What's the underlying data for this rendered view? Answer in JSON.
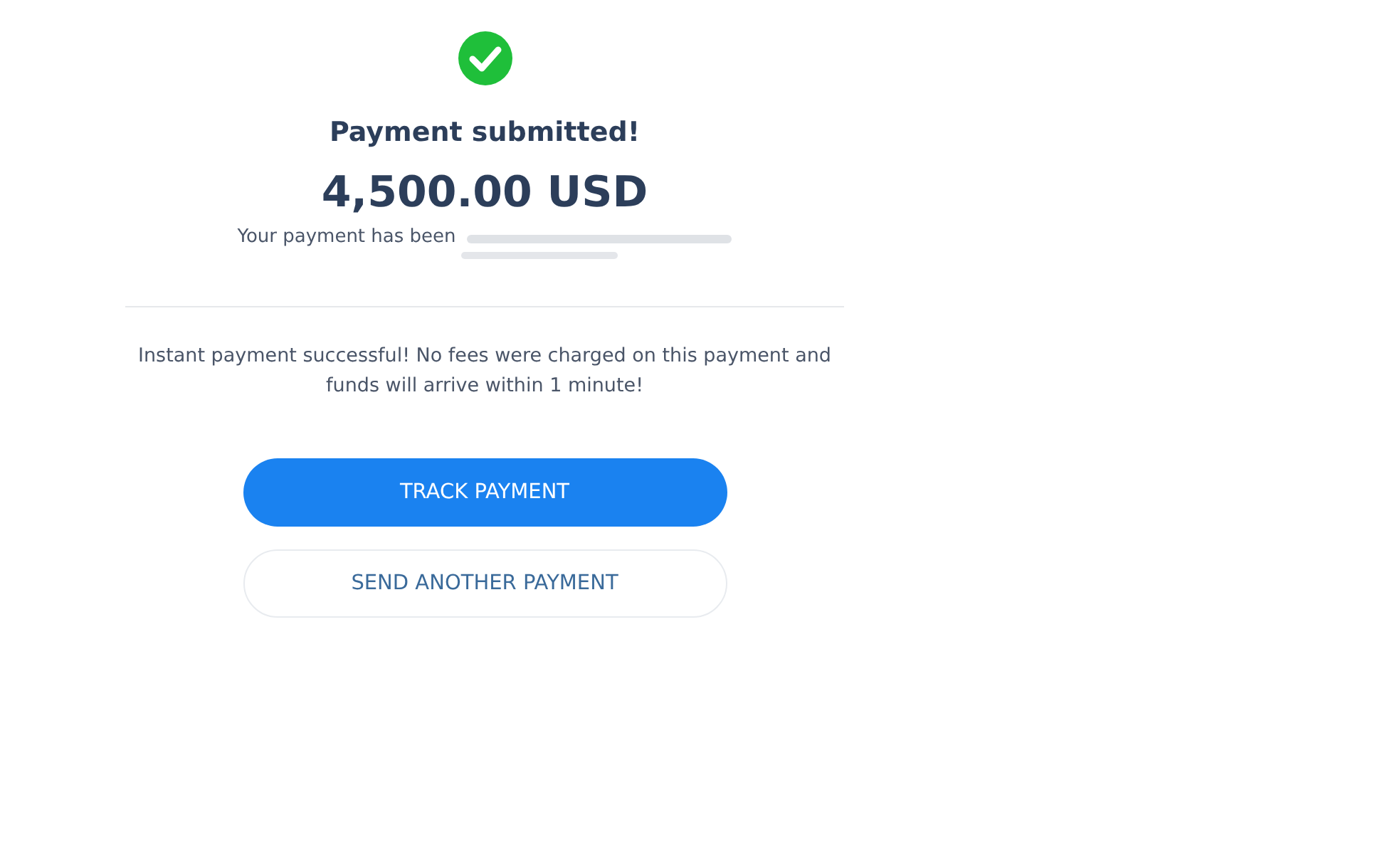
{
  "status": {
    "title": "Payment submitted!",
    "amount": "4,500.00 USD",
    "recipient_note": "Your payment has been"
  },
  "message": "Instant payment successful! No fees were charged on this payment and funds will arrive within 1 minute!",
  "buttons": [
    {
      "label": "TRACK PAYMENT",
      "kind": "primary"
    },
    {
      "label": "SEND ANOTHER PAYMENT",
      "kind": "secondary"
    }
  ]
}
